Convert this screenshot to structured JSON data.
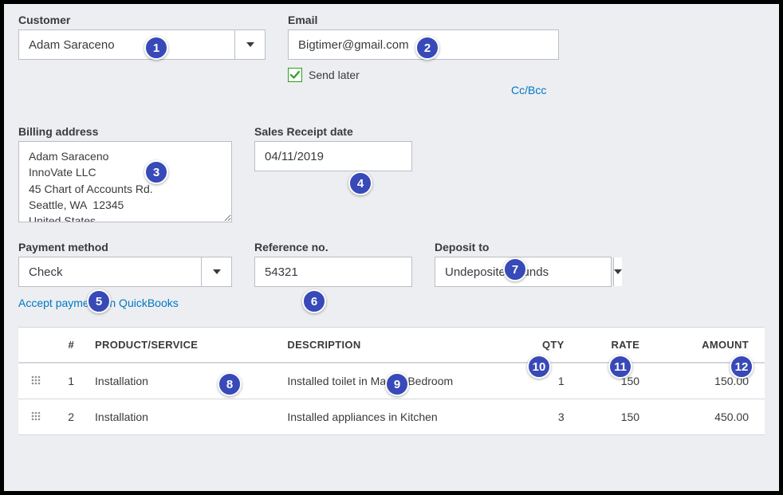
{
  "labels": {
    "customer": "Customer",
    "email": "Email",
    "send_later": "Send later",
    "ccbcc": "Cc/Bcc",
    "billing_address": "Billing address",
    "receipt_date": "Sales Receipt date",
    "payment_method": "Payment method",
    "reference_no": "Reference no.",
    "deposit_to": "Deposit to",
    "accept_payments": "Accept payments in QuickBooks"
  },
  "values": {
    "customer": "Adam Saraceno",
    "email": "Bigtimer@gmail.com",
    "billing_address": "Adam Saraceno\nInnoVate LLC\n45 Chart of Accounts Rd.\nSeattle, WA  12345\nUnited States",
    "receipt_date": "04/11/2019",
    "payment_method": "Check",
    "reference_no": "54321",
    "deposit_to": "Undeposited Funds"
  },
  "table": {
    "headers": {
      "num": "#",
      "product": "PRODUCT/SERVICE",
      "description": "DESCRIPTION",
      "qty": "QTY",
      "rate": "RATE",
      "amount": "AMOUNT"
    },
    "rows": [
      {
        "num": "1",
        "product": "Installation",
        "description": "Installed toilet in Master Bedroom",
        "qty": "1",
        "rate": "150",
        "amount": "150.00"
      },
      {
        "num": "2",
        "product": "Installation",
        "description": "Installed appliances in Kitchen",
        "qty": "3",
        "rate": "150",
        "amount": "450.00"
      }
    ]
  },
  "callouts": {
    "c1": "1",
    "c2": "2",
    "c3": "3",
    "c4": "4",
    "c5": "5",
    "c6": "6",
    "c7": "7",
    "c8": "8",
    "c9": "9",
    "c10": "10",
    "c11": "11",
    "c12": "12"
  }
}
